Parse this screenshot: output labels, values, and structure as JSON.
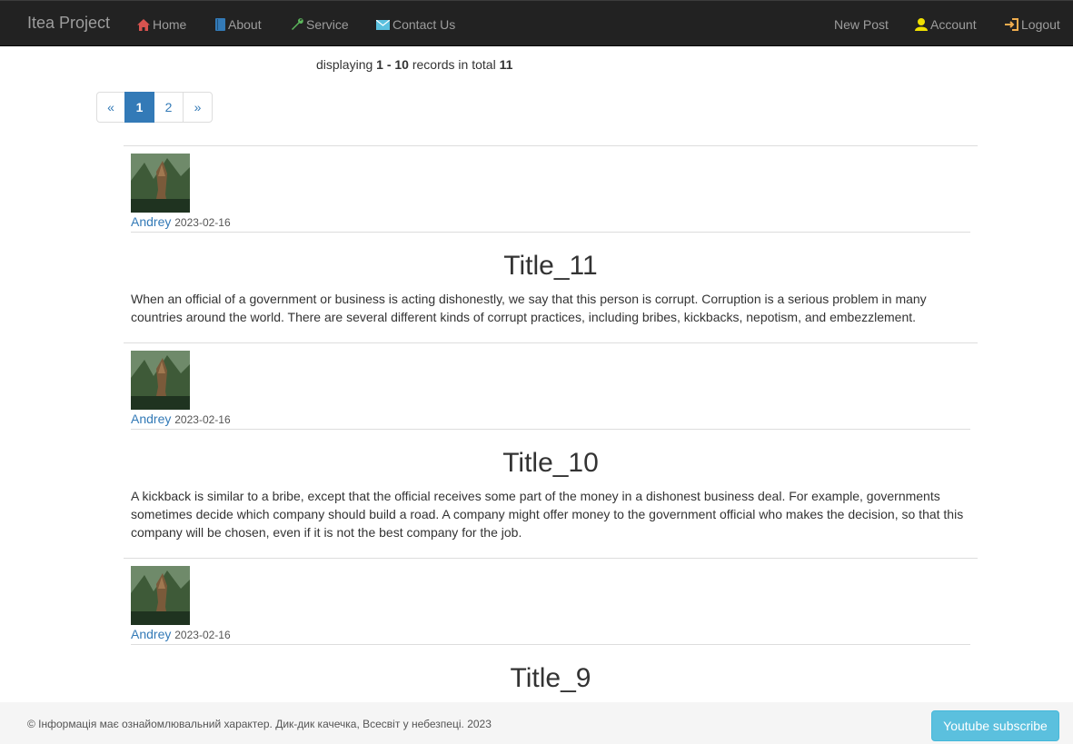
{
  "navbar": {
    "brand": "Itea Project",
    "items": [
      {
        "label": "Home",
        "icon": "home-icon"
      },
      {
        "label": "About",
        "icon": "book-icon"
      },
      {
        "label": "Service",
        "icon": "wrench-icon"
      },
      {
        "label": "Contact Us",
        "icon": "envelope-icon"
      }
    ],
    "right": [
      {
        "label": "New Post"
      },
      {
        "label": "Account",
        "icon": "user-icon"
      },
      {
        "label": "Logout",
        "icon": "logout-icon"
      }
    ]
  },
  "records": {
    "prefix": "displaying",
    "range": "1 - 10",
    "middle": "records in total",
    "total": "11"
  },
  "pagination": {
    "prev": "«",
    "pages": [
      "1",
      "2"
    ],
    "next": "»",
    "active": "1"
  },
  "posts": [
    {
      "author": "Andrey",
      "date": "2023-02-16",
      "title": "Title_11",
      "body": "When an official of a government or business is acting dishonestly, we say that this person is corrupt. Corruption is a serious problem in many countries around the world. There are several different kinds of corrupt practices, including bribes, kickbacks, nepotism, and embezzlement."
    },
    {
      "author": "Andrey",
      "date": "2023-02-16",
      "title": "Title_10",
      "body": "A kickback is similar to a bribe, except that the official receives some part of the money in a dishonest business deal. For example, governments sometimes decide which company should build a road. A company might offer money to the government official who makes the decision, so that this company will be chosen, even if it is not the best company for the job."
    },
    {
      "author": "Andrey",
      "date": "2023-02-16",
      "title": "Title_9",
      "body": ""
    }
  ],
  "footer": {
    "text": "© Інформація має ознайомлювальний характер. Дик-дик качечка, Всесвіт у небезпеці. 2023",
    "button": "Youtube subscribe"
  },
  "colors": {
    "navbar_bg": "#222222",
    "link": "#337ab7",
    "home_icon": "#d9534f",
    "about_icon": "#337ab7",
    "service_icon": "#5cb85c",
    "contact_icon": "#5bc0de",
    "account_icon": "#f0e000",
    "logout_icon": "#f0ad4e",
    "button_info": "#5bc0de"
  }
}
